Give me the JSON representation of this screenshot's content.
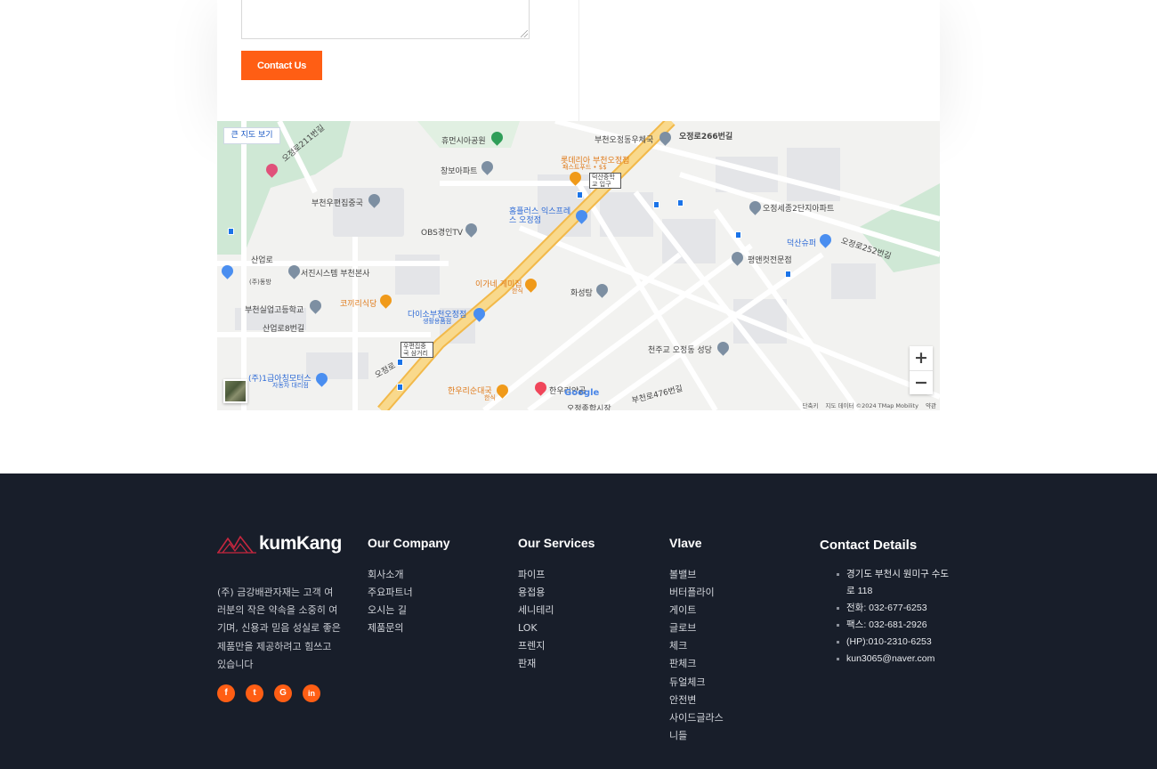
{
  "contact_form": {
    "submit_label": "Contact Us"
  },
  "map": {
    "big_map_label": "큰 지도 보기",
    "zoom_in": "+",
    "zoom_out": "−",
    "footer": [
      "단축키",
      "지도 데이터 ©2024 TMap Mobility",
      "약관"
    ],
    "labels": {
      "park": "휴먼시아공원",
      "post_office": "부천오정동우체국",
      "road_266": "오정로266번길",
      "lotteria": "롯데리아 부천오정점",
      "lotteria_sub": "패스트푸드 • $$",
      "school_stop": "덕산중학교 입구",
      "changbo": "창보아파트",
      "postal_center": "부천우편집중국",
      "homeplus": "홈플러스 익스프레스 오정점",
      "apt2": "오정세종2단지아파트",
      "obs": "OBS경인TV",
      "deoksan": "덕산슈퍼",
      "road_252": "오정로252번길",
      "sanup": "산업로",
      "seojin": "서진시스템 부천본사",
      "pyeong": "평앤컷전문점",
      "dongbang": "(주)동방",
      "igane": "이가네 게미집",
      "igane_sub": "한식",
      "hwaseong": "화성탕",
      "kokiri": "코끼리식당",
      "daiso": "다이소부천오정점",
      "daiso_sub": "생활용품점",
      "silup": "부천실업고등학교",
      "sanup8": "산업로8번길",
      "junction": "우편집중국 삼거리",
      "cheonju": "천주교 오정동 성당",
      "motors": "(주)1급아칭모터스",
      "motors_sub": "자동차 대리점",
      "jeongro": "오정로",
      "hanwoo": "한우리순대국",
      "hanwoo_sub": "한식",
      "hanuri": "한우리양곱",
      "road_476": "부천로476번길",
      "market": "오정종합시장",
      "road_211": "오정로211번길",
      "google": "Google"
    }
  },
  "footer": {
    "brand": "kumKang",
    "about": "(주) 금강배관자재는 고객 여러분의 작은 약속을 소중히 여기며, 신용과 믿음 성실로 좋은 제품만을 제공하려고 힘쓰고 있습니다",
    "socials": [
      {
        "icon": "facebook-icon",
        "glyph": "f"
      },
      {
        "icon": "twitter-icon",
        "glyph": "t"
      },
      {
        "icon": "google-icon",
        "glyph": "G"
      },
      {
        "icon": "linkedin-icon",
        "glyph": "in"
      }
    ],
    "company": {
      "title": "Our Company",
      "items": [
        "회사소개",
        "주요파트너",
        "오시는 길",
        "제품문의"
      ]
    },
    "services": {
      "title": "Our Services",
      "items": [
        "파이프",
        "용접용",
        "세니테리",
        "LOK",
        "프렌지",
        "판재"
      ]
    },
    "vlave": {
      "title": "Vlave",
      "items": [
        "볼밸브",
        "버터플라이",
        "게이트",
        "글로브",
        "체크",
        "판체크",
        "듀얼체크",
        "안전변",
        "사이드글라스",
        "니들"
      ]
    },
    "contact": {
      "title": "Contact Details",
      "items": [
        "경기도 부천시 원미구 수도로 118",
        "전화: 032-677-6253",
        "팩스: 032-681-2926",
        "(HP):010-2310-6253",
        "kun3065@naver.com"
      ]
    }
  },
  "colors": {
    "accent": "#ff5e14",
    "footer_bg": "#181e2a",
    "road_main": "#f7c86a"
  }
}
